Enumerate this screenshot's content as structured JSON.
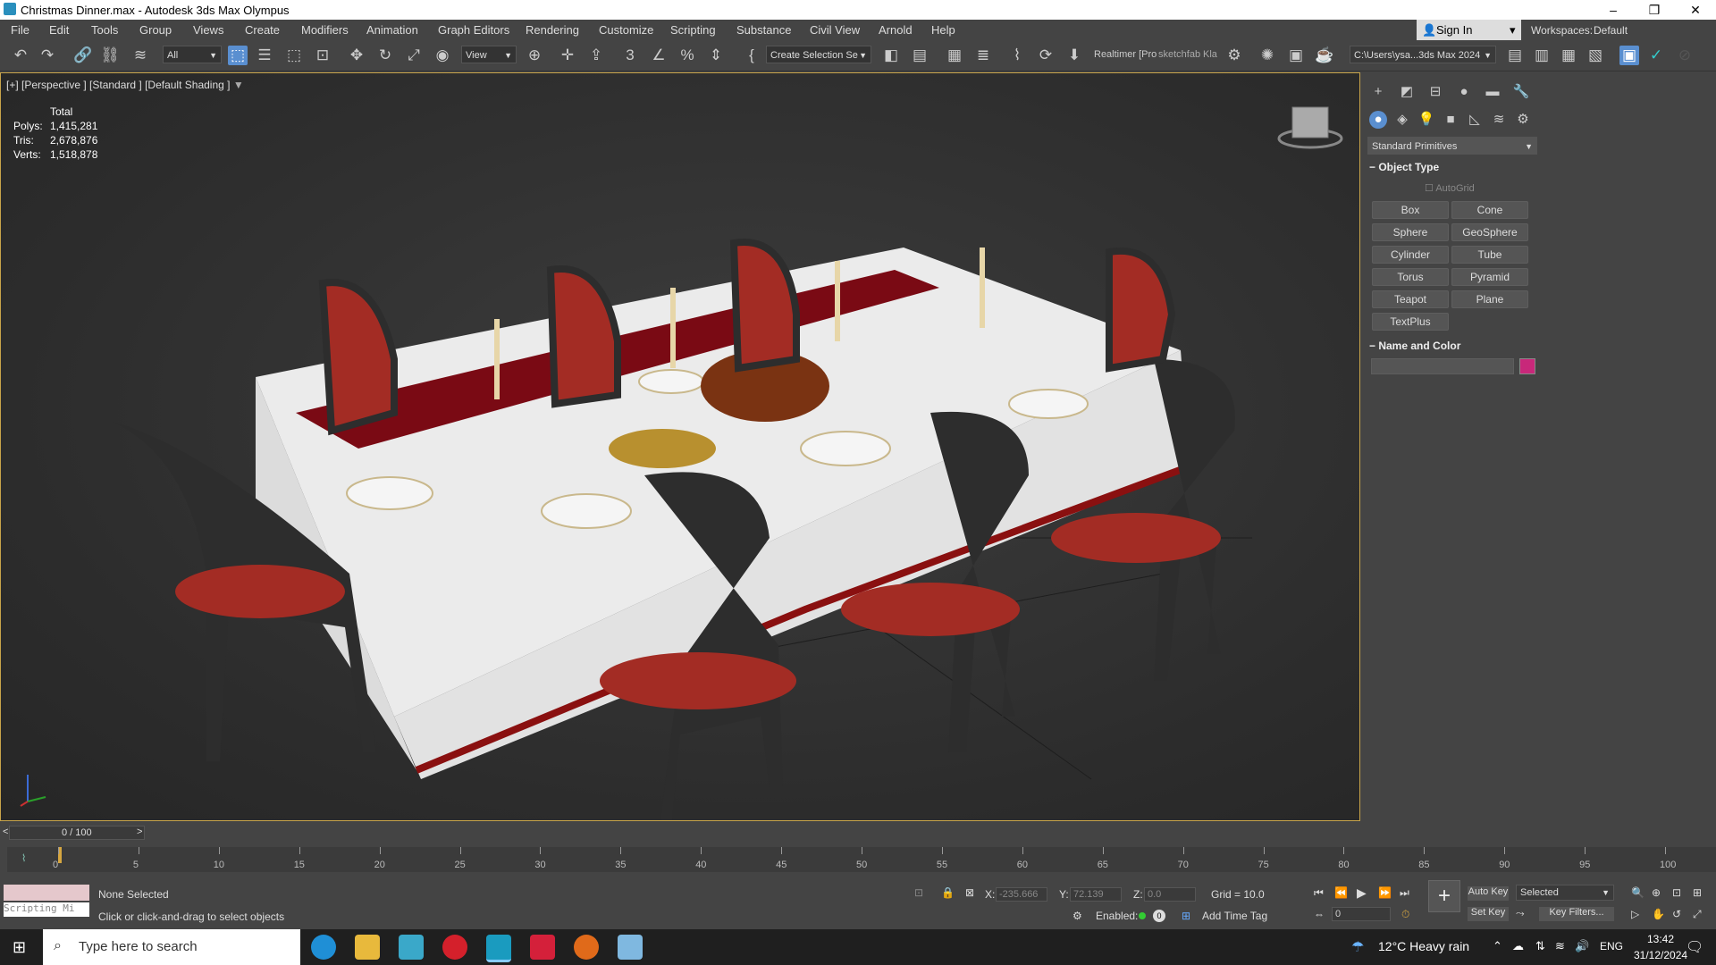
{
  "window": {
    "title": "Christmas Dinner.max - Autodesk 3ds Max Olympus",
    "min": "–",
    "max": "❐",
    "close": "✕"
  },
  "menu": [
    "File",
    "Edit",
    "Tools",
    "Group",
    "Views",
    "Create",
    "Modifiers",
    "Animation",
    "Graph Editors",
    "Rendering",
    "Customize",
    "Scripting",
    "Substance",
    "Civil View",
    "Arnold",
    "Help"
  ],
  "account": {
    "signin": "Sign In",
    "workspaces_label": "Workspaces:",
    "workspace": "Default"
  },
  "toolbar": {
    "selection_filter": "All",
    "ref_coord": "View",
    "named_selection": "Create Selection Se",
    "plugin_text_1": "Realtimer [Pro",
    "plugin_text_2": "sketchfab",
    "plugin_text_3": "Kla",
    "project_path": "C:\\Users\\ysa...3ds Max 2024"
  },
  "viewport": {
    "label": "[+] [Perspective ] [Standard ] [Default Shading ]",
    "stats": {
      "header": "Total",
      "polys_label": "Polys:",
      "polys": "1,415,281",
      "tris_label": "Tris:",
      "tris": "2,678,876",
      "verts_label": "Verts:",
      "verts": "1,518,878"
    }
  },
  "command_panel": {
    "category": "Standard Primitives",
    "object_type_title": "Object Type",
    "autogrid": "AutoGrid",
    "buttons": [
      "Box",
      "Cone",
      "Sphere",
      "GeoSphere",
      "Cylinder",
      "Tube",
      "Torus",
      "Pyramid",
      "Teapot",
      "Plane",
      "TextPlus"
    ],
    "name_color_title": "Name and Color",
    "color": "#c8287a"
  },
  "timeline": {
    "frame": "0 / 100",
    "ticks": [
      "0",
      "5",
      "10",
      "15",
      "20",
      "25",
      "30",
      "35",
      "40",
      "45",
      "50",
      "55",
      "60",
      "65",
      "70",
      "75",
      "80",
      "85",
      "90",
      "95",
      "100"
    ]
  },
  "status": {
    "script_listener": "Scripting Mi",
    "selection": "None Selected",
    "prompt": "Click or click-and-drag to select objects",
    "x_label": "X:",
    "x": "-235.666",
    "y_label": "Y:",
    "y": "72.139",
    "z_label": "Z:",
    "z": "0.0",
    "grid": "Grid = 10.0",
    "enabled": "Enabled:",
    "add_time_tag": "Add Time Tag",
    "auto_key": "Auto Key",
    "set_key": "Set Key",
    "key_mode": "Selected",
    "key_filters": "Key Filters...",
    "frame_field": "0"
  },
  "taskbar": {
    "search": "Type here to search",
    "weather": "12°C  Heavy rain",
    "lang": "ENG",
    "time": "13:42",
    "date": "31/12/2024"
  }
}
